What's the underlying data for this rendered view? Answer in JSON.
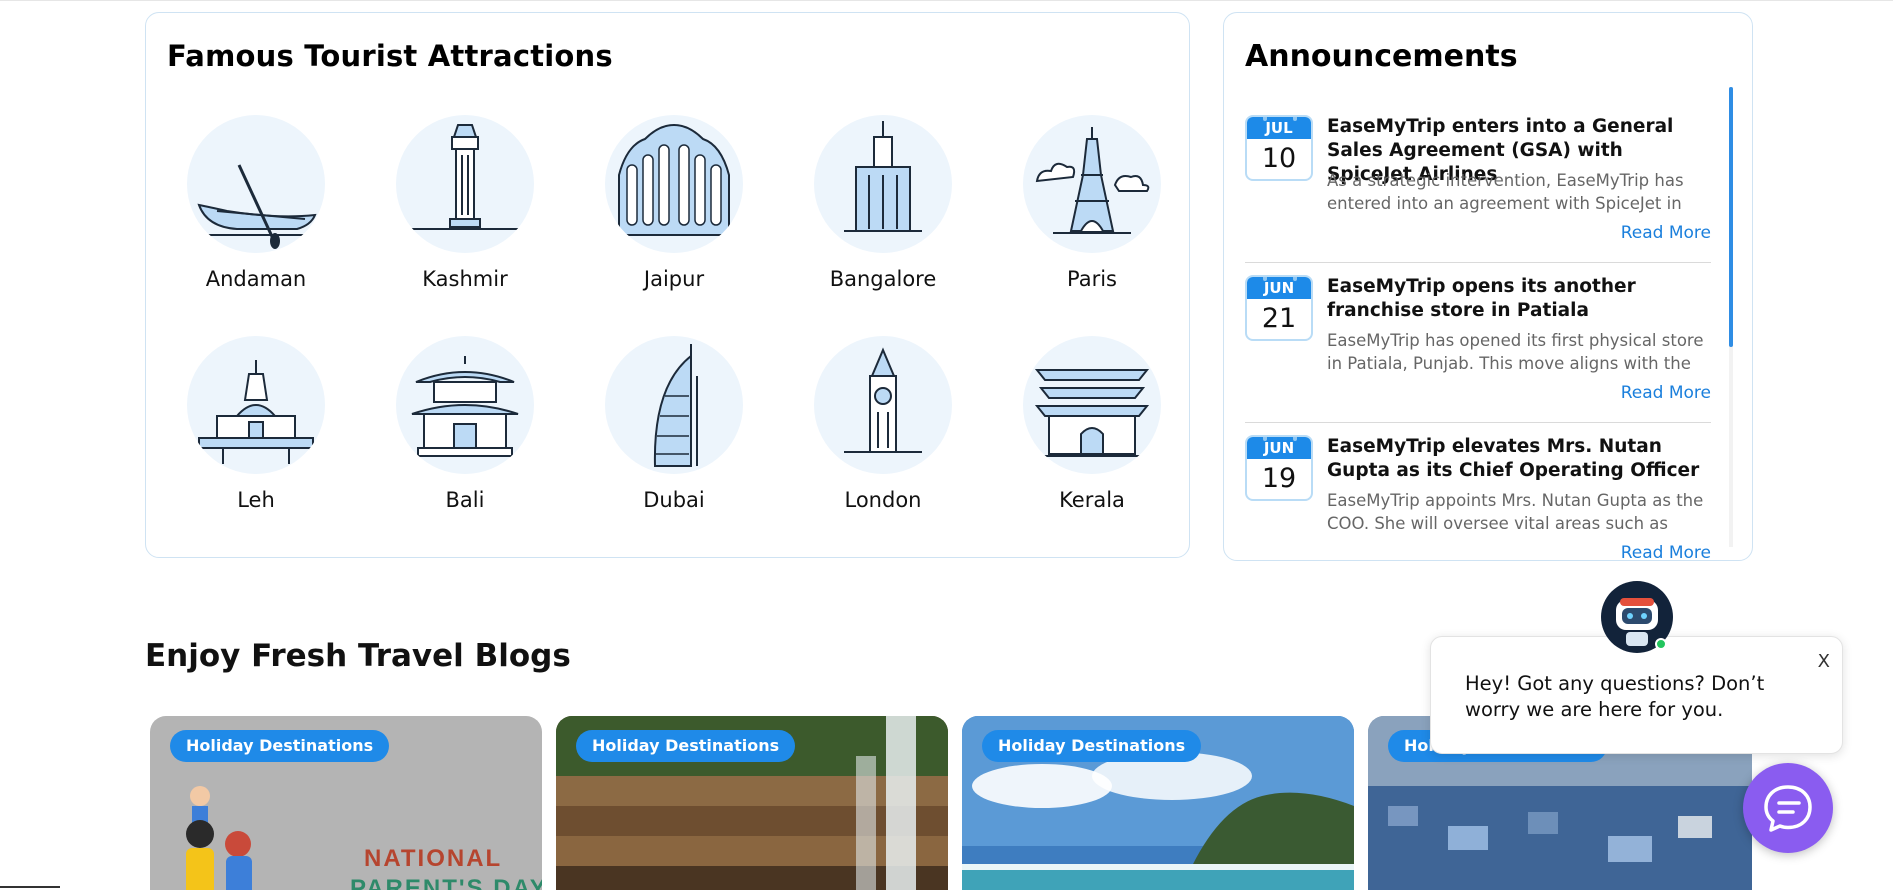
{
  "attractions": {
    "title": "Famous Tourist Attractions",
    "items": [
      {
        "label": "Andaman",
        "icon": "boat-icon"
      },
      {
        "label": "Kashmir",
        "icon": "clock-tower-icon"
      },
      {
        "label": "Jaipur",
        "icon": "hawa-mahal-icon"
      },
      {
        "label": "Bangalore",
        "icon": "skyscraper-icon"
      },
      {
        "label": "Paris",
        "icon": "eiffel-tower-icon"
      },
      {
        "label": "Leh",
        "icon": "stupa-icon"
      },
      {
        "label": "Bali",
        "icon": "pagoda-icon"
      },
      {
        "label": "Dubai",
        "icon": "burj-al-arab-icon"
      },
      {
        "label": "London",
        "icon": "big-ben-icon"
      },
      {
        "label": "Kerala",
        "icon": "temple-icon"
      }
    ]
  },
  "announcements": {
    "title": "Announcements",
    "items": [
      {
        "month": "JUL",
        "day": "10",
        "title": "EaseMyTrip enters into a General Sales Agreement (GSA) with SpiceJet Airlines",
        "text": "As a strategic intervention, EaseMyTrip has entered into an agreement with SpiceJet in order",
        "more": "Read More"
      },
      {
        "month": "JUN",
        "day": "21",
        "title": "EaseMyTrip opens its another franchise store in Patiala",
        "text": "EaseMyTrip has opened its first physical store in Patiala, Punjab. This move aligns with the",
        "more": "Read More"
      },
      {
        "month": "JUN",
        "day": "19",
        "title": "EaseMyTrip elevates Mrs. Nutan Gupta as its Chief Operating Officer",
        "text": "EaseMyTrip appoints Mrs. Nutan Gupta as the COO. She will oversee vital areas such as",
        "more": "Read More"
      }
    ]
  },
  "blogs": {
    "title": "Enjoy Fresh Travel Blogs",
    "cards": [
      {
        "badge": "Holiday Destinations",
        "image_text_1": "NATIONAL",
        "image_text_2": "PARENT'S DAY"
      },
      {
        "badge": "Holiday Destinations"
      },
      {
        "badge": "Holiday Destinations"
      },
      {
        "badge": "Holiday Destinations"
      }
    ]
  },
  "chat": {
    "message": "Hey! Got any questions? Don’t worry we are here for you.",
    "close": "X"
  },
  "colors": {
    "accent": "#1f8ae8",
    "circle_bg": "#edf5fc",
    "chat_fab": "#8a5cf0"
  }
}
